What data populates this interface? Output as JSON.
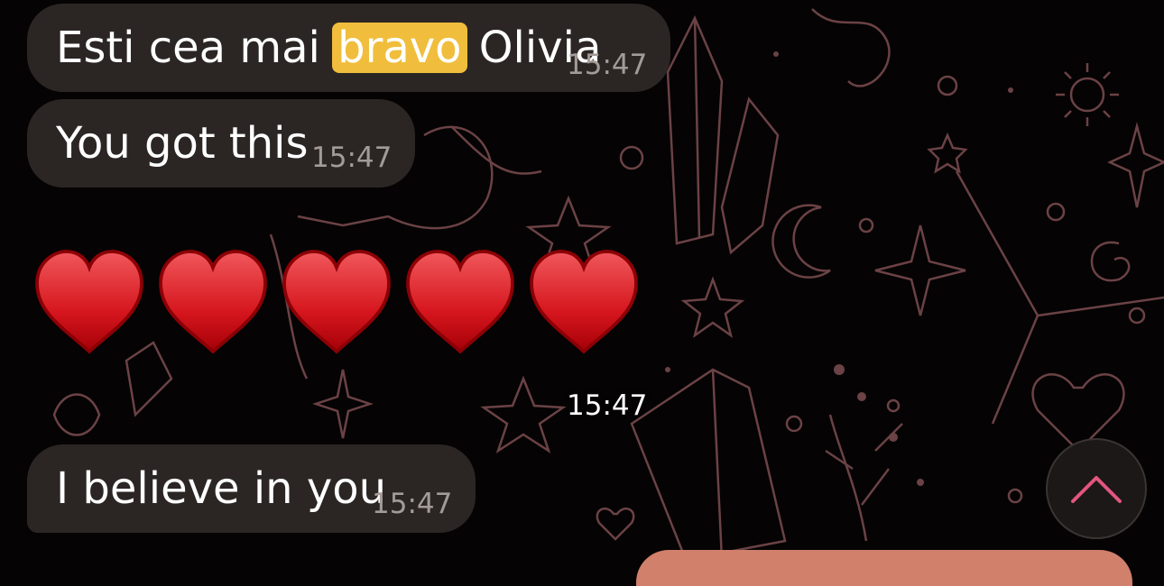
{
  "messages": [
    {
      "before": "Esti cea mai ",
      "highlight": "bravo",
      "after": " Olivia",
      "time": "15:47"
    },
    {
      "text": "You got this",
      "time": "15:47"
    },
    {
      "emoji": "♥♥♥♥♥",
      "time": "15:47"
    },
    {
      "text": "I believe in you",
      "time": "15:47"
    }
  ],
  "colors": {
    "incoming_bubble": "#2b2624",
    "highlight": "#f0be3c",
    "accent": "#e2567e",
    "outgoing_bubble": "#d0806b"
  },
  "icons": [
    "heart-emoji",
    "chevron-up-icon"
  ]
}
